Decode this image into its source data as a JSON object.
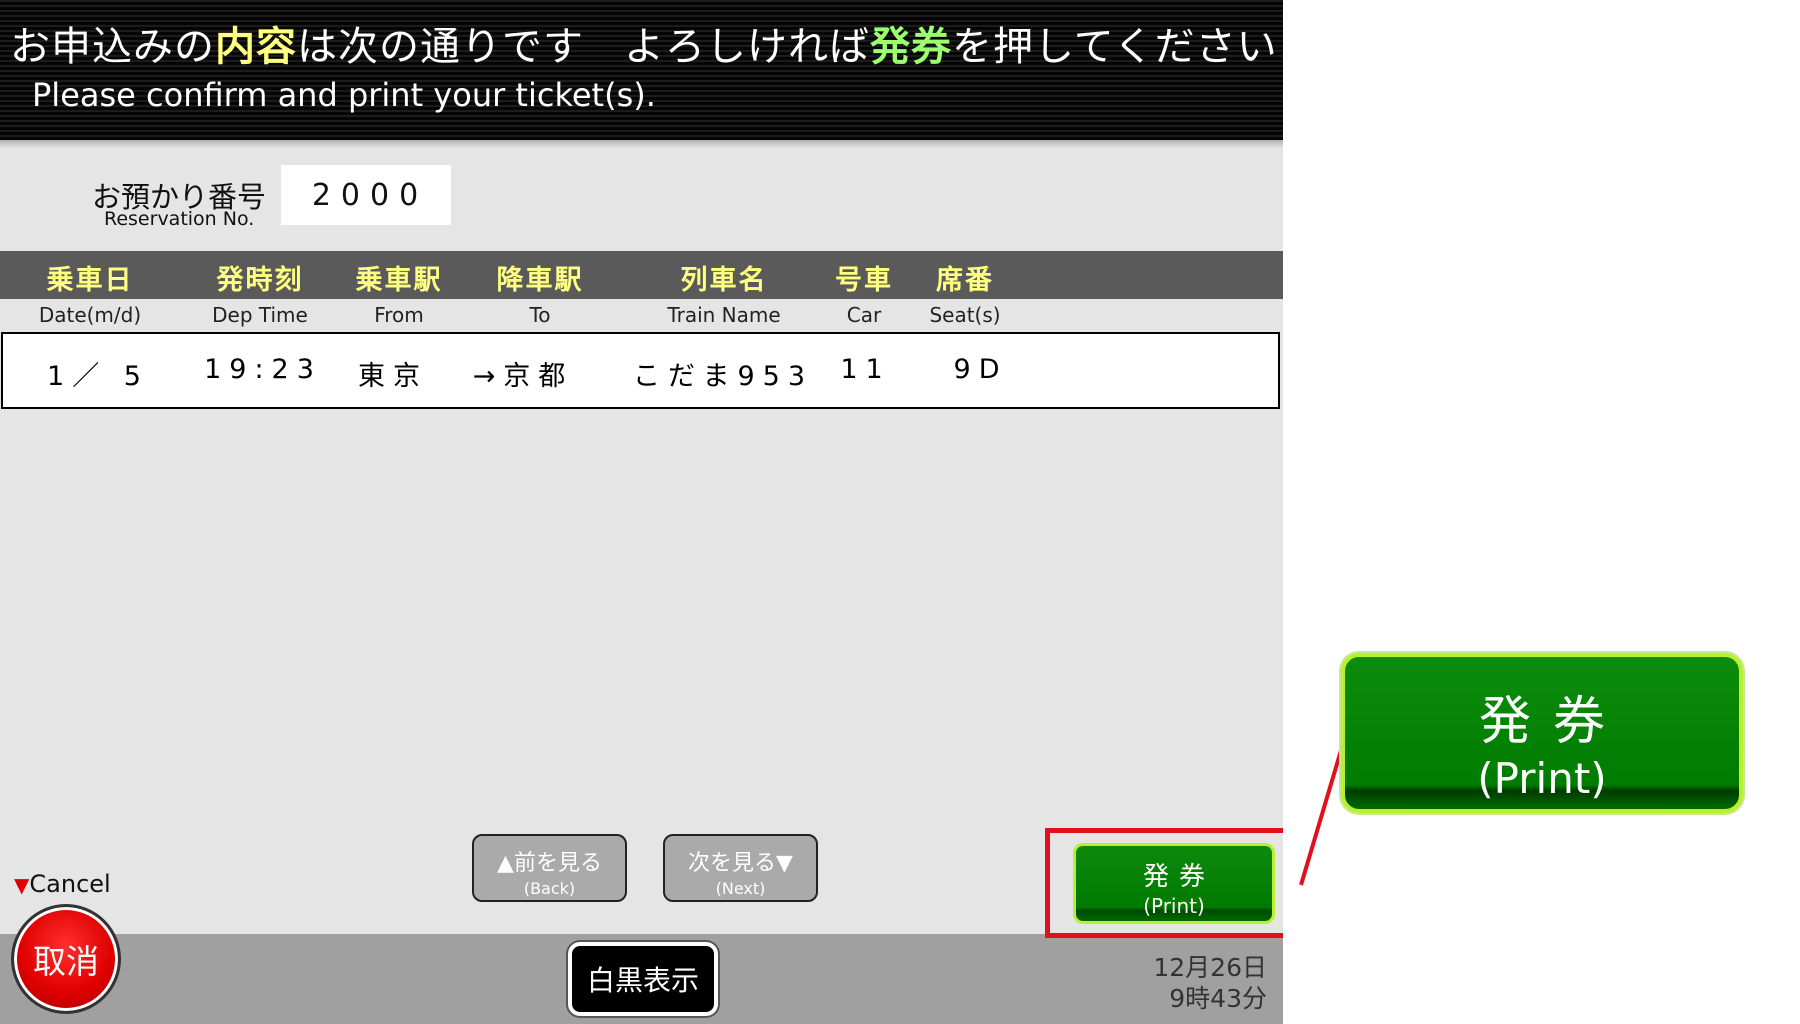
{
  "header": {
    "jp_prefix": "お申込みの",
    "jp_highlight1": "内容",
    "jp_middle": "は次の通りです",
    "jp_second_prefix": "よろしければ",
    "jp_highlight2": "発券",
    "jp_suffix": "を押してください",
    "en": "Please confirm and print your ticket(s)."
  },
  "reservation": {
    "label_jp": "お預かり番号",
    "label_en": "Reservation No.",
    "value": "2000"
  },
  "table": {
    "headers": [
      {
        "jp": "乗車日",
        "en": "Date(m/d)"
      },
      {
        "jp": "発時刻",
        "en": "Dep Time"
      },
      {
        "jp": "乗車駅",
        "en": "From"
      },
      {
        "jp": "降車駅",
        "en": "To"
      },
      {
        "jp": "列車名",
        "en": "Train Name"
      },
      {
        "jp": "号車",
        "en": "Car"
      },
      {
        "jp": "席番",
        "en": "Seat(s)"
      }
    ],
    "rows": [
      [
        "1／ 5",
        "19:23",
        "東京",
        "→京都",
        "こだま953",
        "11",
        "9D"
      ]
    ]
  },
  "nav": {
    "back_jp": "▲前を見る",
    "back_en": "(Back)",
    "next_jp": "次を見る▼",
    "next_en": "(Next)"
  },
  "cancel": {
    "caption": "Cancel",
    "label": "取消"
  },
  "mono_button": "白黒表示",
  "print_button": {
    "jp": "発券",
    "en": "(Print)"
  },
  "datetime": {
    "date": "12月26日",
    "time": "9時43分"
  },
  "colors": {
    "header_highlight_yellow": "#ffff80",
    "header_highlight_green": "#9cff70",
    "print_green": "#007a00",
    "cancel_red": "#e00000",
    "callout_red": "#e0101e"
  }
}
